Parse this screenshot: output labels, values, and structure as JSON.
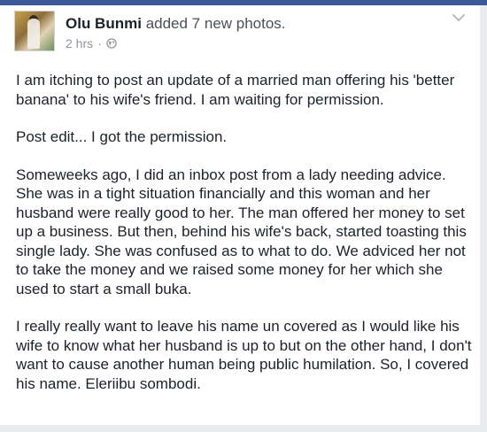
{
  "post": {
    "author": "Olu Bunmi",
    "action": "added 7 new photos.",
    "time": "2 hrs",
    "separator": "·",
    "privacy_icon": "globe-icon",
    "menu_icon": "chevron-down-icon",
    "paragraphs": [
      "I am itching to post an update of a married man offering his 'better banana' to his wife's friend. I am waiting for permission.",
      "Post edit... I got the permission.",
      "Someweeks ago, I did an inbox post from a lady needing advice. She was in a tight situation financially and this woman and her husband were really good to her. The man offered her money to set up a business. But then, behind his wife's back, started toasting this single lady. She was confused as to what to do. We adviced her not to take the money and we raised some money for her which she used to start a small buka.",
      "I really really want to leave his name un covered as I would like his wife to know what her husband is up to but on the other hand, I don't want to cause another human being public humilation. So, I covered his name. Eleriibu sombodi."
    ]
  },
  "colors": {
    "brand": "#3b5998",
    "text": "#1d2129",
    "meta": "#90949c"
  }
}
